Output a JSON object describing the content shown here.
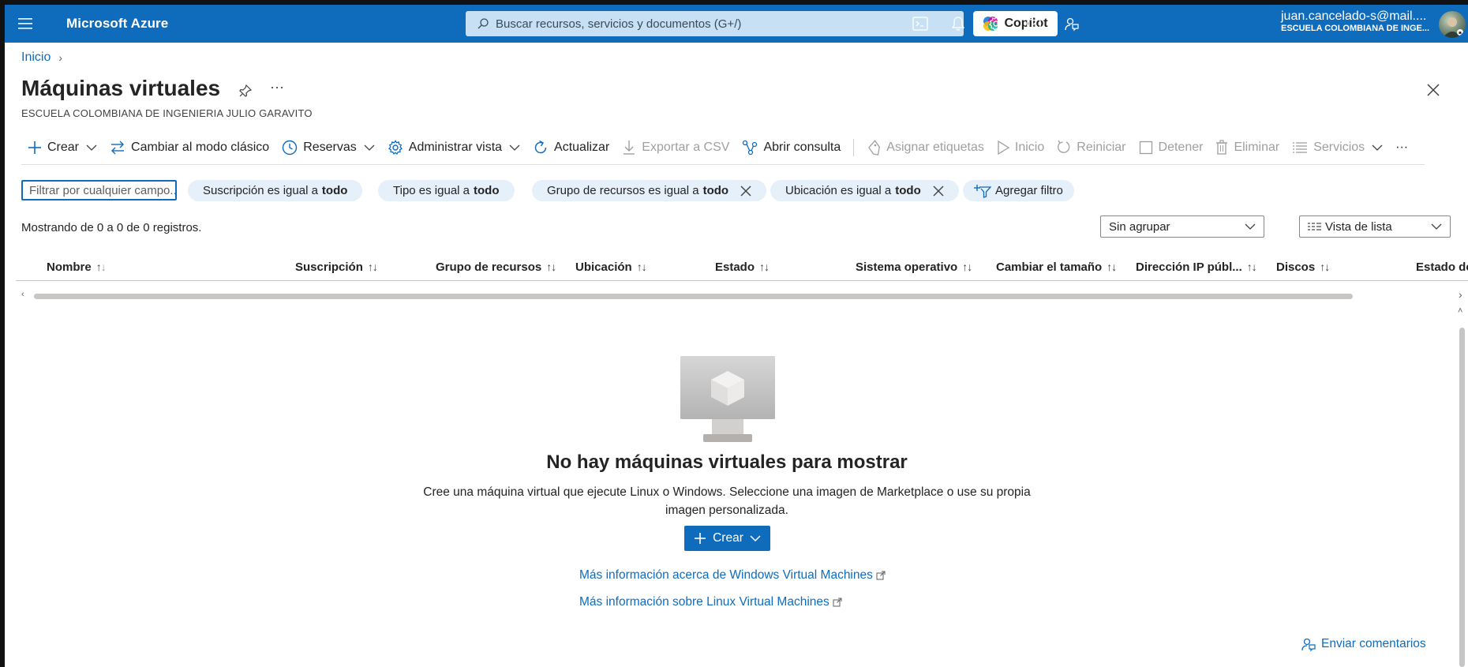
{
  "app": {
    "brand": "Microsoft Azure",
    "search_placeholder": "Buscar recursos, servicios y documentos (G+/)",
    "copilot_label": "Copilot",
    "account_email": "juan.cancelado-s@mail....",
    "account_tenant": "ESCUELA COLOMBIANA DE INGE...",
    "accent_color": "#0f6cbd"
  },
  "breadcrumb": {
    "home": "Inicio"
  },
  "page": {
    "title": "Máquinas virtuales",
    "subtitle": "ESCUELA COLOMBIANA DE INGENIERIA JULIO GARAVITO",
    "more": "···"
  },
  "toolbar": {
    "create": "Crear",
    "classic": "Cambiar al modo clásico",
    "reservations": "Reservas",
    "manage_view": "Administrar vista",
    "refresh": "Actualizar",
    "export_csv": "Exportar a CSV",
    "open_query": "Abrir consulta",
    "assign_tags": "Asignar etiquetas",
    "start": "Inicio",
    "restart": "Reiniciar",
    "stop": "Detener",
    "delete": "Eliminar",
    "services": "Servicios",
    "more": "···"
  },
  "filters": {
    "input_placeholder": "Filtrar por cualquier campo...",
    "subscription_prefix": "Suscripción es igual a",
    "type_prefix": "Tipo es igual a",
    "resource_group_prefix": "Grupo de recursos es igual a",
    "location_prefix": "Ubicación es igual a",
    "value_all": "todo",
    "add_filter": "Agregar filtro"
  },
  "records": {
    "count_text": "Mostrando de 0 a 0 de 0 registros.",
    "grouping": "Sin agrupar",
    "view": "Vista de lista"
  },
  "columns": [
    "Nombre",
    "Suscripción",
    "Grupo de recursos",
    "Ubicación",
    "Estado",
    "Sistema operativo",
    "Cambiar el tamaño",
    "Dirección IP públ...",
    "Discos",
    "Estado de"
  ],
  "empty_state": {
    "title": "No hay máquinas virtuales para mostrar",
    "description": "Cree una máquina virtual que ejecute Linux o Windows. Seleccione una imagen de Marketplace o use su propia imagen personalizada.",
    "create_button": "Crear",
    "link_windows": "Más información acerca de Windows Virtual Machines",
    "link_linux": "Más información sobre Linux Virtual Machines"
  },
  "feedback": "Enviar comentarios"
}
